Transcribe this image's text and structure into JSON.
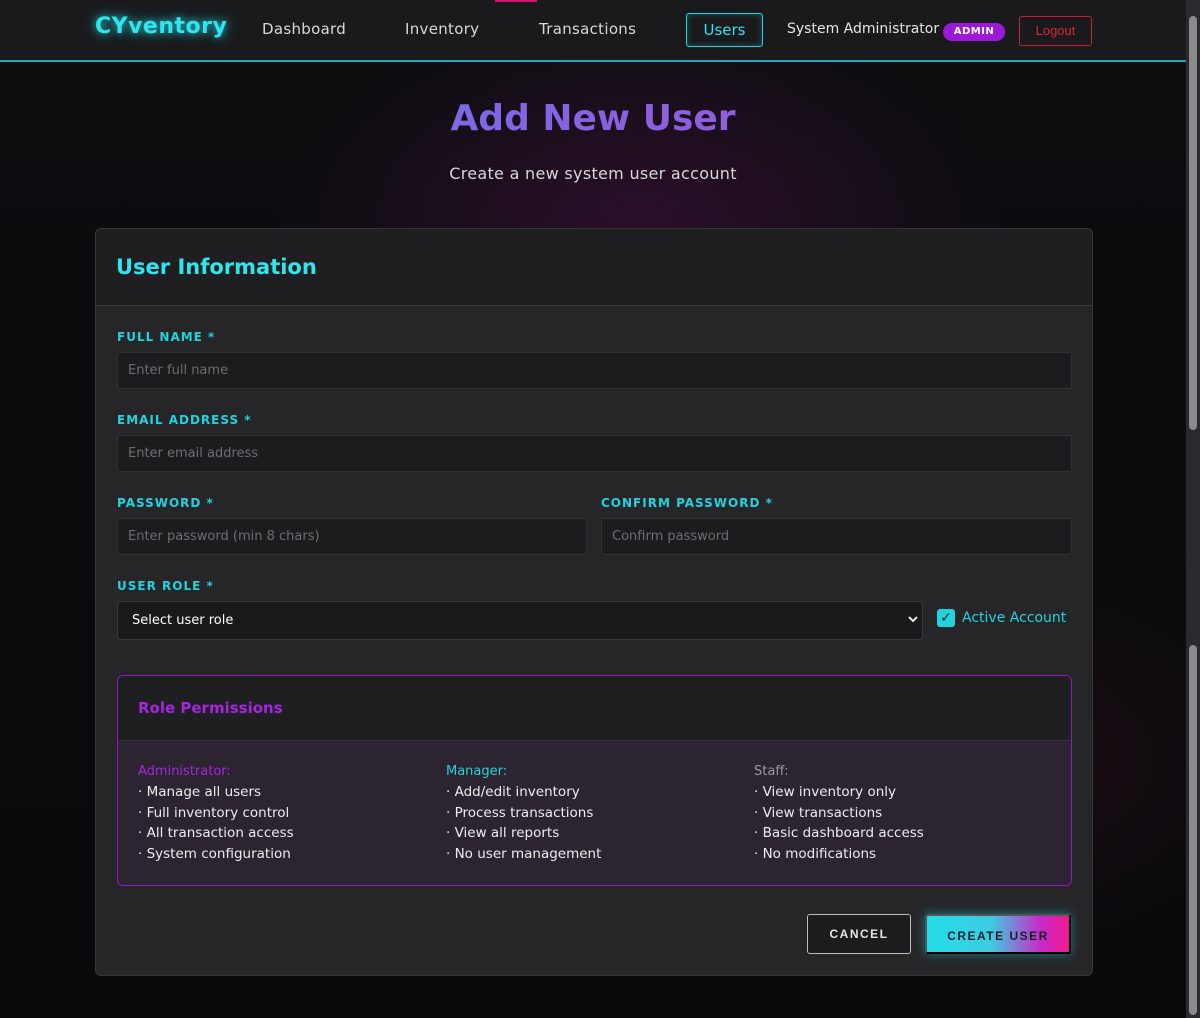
{
  "nav": {
    "brand": "CYventory",
    "links": [
      "Dashboard",
      "Inventory",
      "Transactions",
      "Users"
    ],
    "user_name": "System Administrator",
    "role_badge": "ADMIN",
    "logout": "Logout"
  },
  "header": {
    "title": "Add New User",
    "subtitle": "Create a new system user account"
  },
  "form": {
    "card_title": "User Information",
    "full_name": {
      "label": "FULL NAME *",
      "placeholder": "Enter full name",
      "value": ""
    },
    "email": {
      "label": "EMAIL ADDRESS *",
      "placeholder": "Enter email address",
      "value": ""
    },
    "password": {
      "label": "PASSWORD *",
      "placeholder": "Enter password (min 8 chars)",
      "value": ""
    },
    "confirm_password": {
      "label": "CONFIRM PASSWORD *",
      "placeholder": "Confirm password",
      "value": ""
    },
    "role": {
      "label": "USER ROLE *",
      "selected": "Select user role"
    },
    "active_account": {
      "label": "Active Account",
      "checked": true,
      "check_glyph": "✓"
    }
  },
  "permissions": {
    "title": "Role Permissions",
    "roles": [
      {
        "name": "Administrator:",
        "color": "#a527dd",
        "items": [
          "· Manage all users",
          "· Full inventory control",
          "· All transaction access",
          "· System configuration"
        ]
      },
      {
        "name": "Manager:",
        "color": "#22d3dd",
        "items": [
          "· Add/edit inventory",
          "· Process transactions",
          "· View all reports",
          "· No user management"
        ]
      },
      {
        "name": "Staff:",
        "color": "#9a9a9e",
        "items": [
          "· View inventory only",
          "· View transactions",
          "· Basic dashboard access",
          "· No modifications"
        ]
      }
    ]
  },
  "actions": {
    "cancel": "CANCEL",
    "create": "CREATE USER"
  },
  "colors": {
    "accent_cyan": "#22d3dd",
    "accent_purple": "#a527dd",
    "danger": "#d7263f"
  }
}
